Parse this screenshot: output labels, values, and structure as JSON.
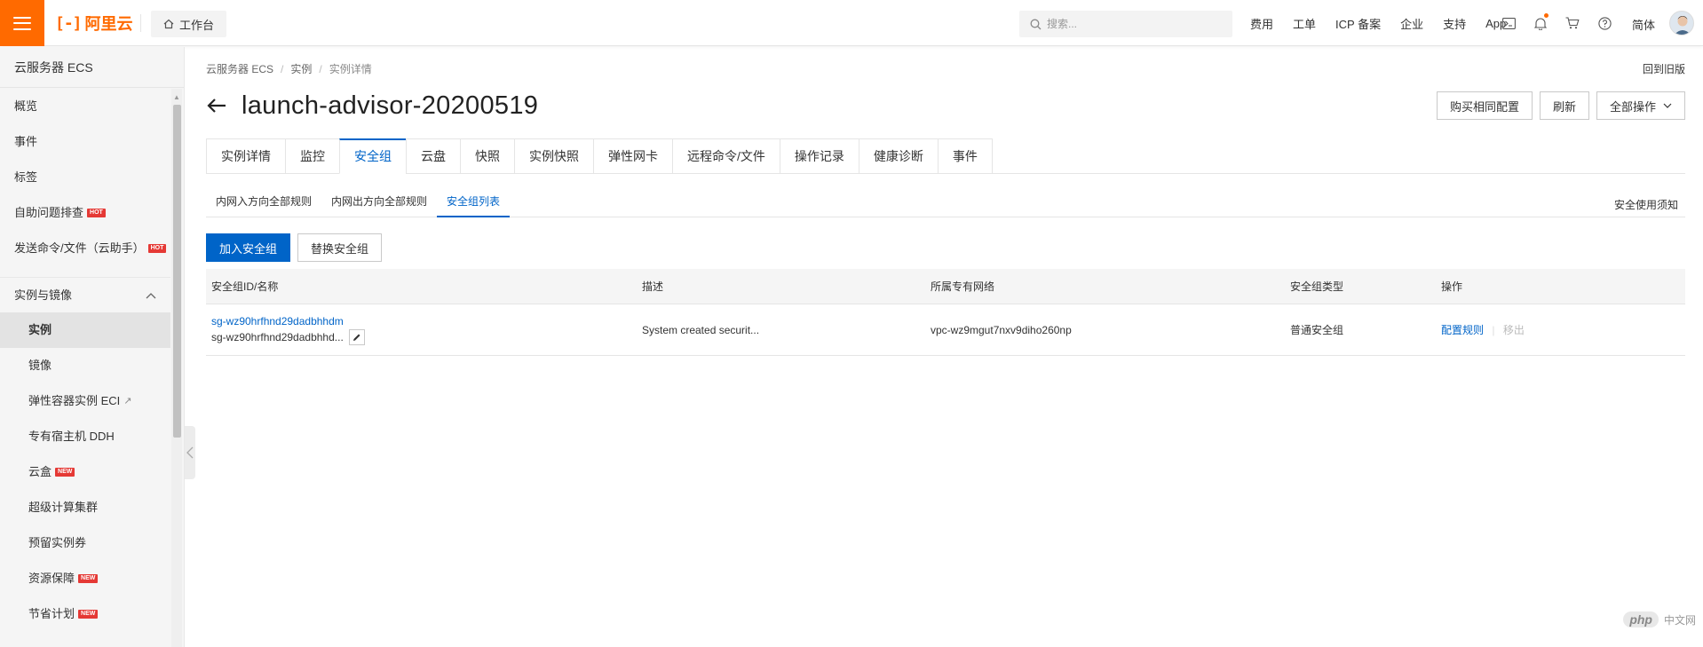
{
  "header": {
    "logo_mark": "[-]",
    "logo_text": "阿里云",
    "workbench": "工作台",
    "search_placeholder": "搜索...",
    "links": [
      "费用",
      "工单",
      "ICP 备案",
      "企业",
      "支持",
      "App"
    ],
    "language": "简体",
    "accent_color": "#ff6a00"
  },
  "sidebar": {
    "title": "云服务器 ECS",
    "items": [
      {
        "label": "概览",
        "badge": ""
      },
      {
        "label": "事件",
        "badge": ""
      },
      {
        "label": "标签",
        "badge": ""
      },
      {
        "label": "自助问题排查",
        "badge": "HOT"
      },
      {
        "label": "发送命令/文件（云助手）",
        "badge": "HOT"
      }
    ],
    "section": {
      "label": "实例与镜像",
      "items": [
        {
          "label": "实例",
          "badge": ""
        },
        {
          "label": "镜像",
          "badge": ""
        },
        {
          "label": "弹性容器实例 ECI",
          "badge": ""
        },
        {
          "label": "专有宿主机 DDH",
          "badge": ""
        },
        {
          "label": "云盒",
          "badge": "NEW"
        },
        {
          "label": "超级计算集群",
          "badge": ""
        },
        {
          "label": "预留实例券",
          "badge": ""
        },
        {
          "label": "资源保障",
          "badge": "NEW"
        },
        {
          "label": "节省计划",
          "badge": "NEW"
        }
      ]
    }
  },
  "main": {
    "breadcrumb": [
      "云服务器 ECS",
      "实例",
      "实例详情"
    ],
    "old_version": "回到旧版",
    "title": "launch-advisor-20200519",
    "actions": {
      "buy_same": "购买相同配置",
      "refresh": "刷新",
      "all_ops": "全部操作"
    },
    "tabs": [
      "实例详情",
      "监控",
      "安全组",
      "云盘",
      "快照",
      "实例快照",
      "弹性网卡",
      "远程命令/文件",
      "操作记录",
      "健康诊断",
      "事件"
    ],
    "subtabs": [
      "内网入方向全部规则",
      "内网出方向全部规则",
      "安全组列表"
    ],
    "notice": "安全使用须知",
    "buttons": {
      "join": "加入安全组",
      "replace": "替换安全组"
    },
    "table": {
      "headers": [
        "安全组ID/名称",
        "描述",
        "所属专有网络",
        "安全组类型",
        "操作"
      ],
      "rows": [
        {
          "id": "sg-wz90hrfhnd29dadbhhdm",
          "name": "sg-wz90hrfhnd29dadbhhd...",
          "description": "System created securit...",
          "vpc": "vpc-wz9mgut7nxv9diho260np",
          "type": "普通安全组",
          "op_config": "配置规则",
          "op_remove": "移出"
        }
      ]
    }
  },
  "watermark": {
    "logo": "php",
    "text": "中文网"
  }
}
